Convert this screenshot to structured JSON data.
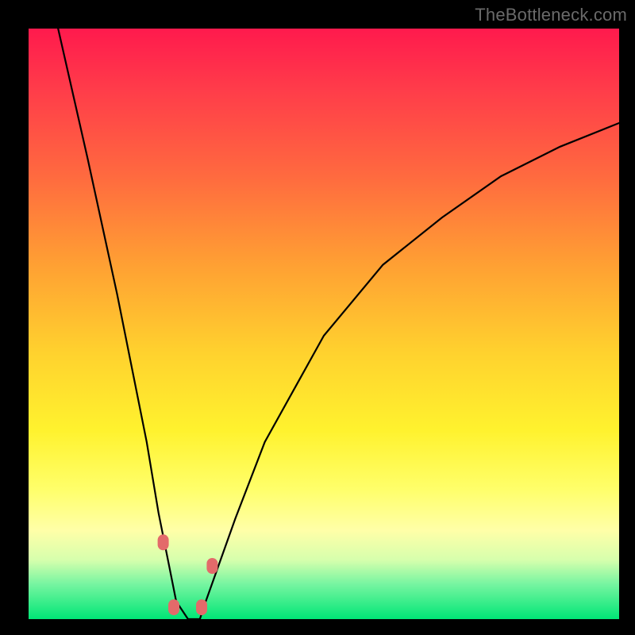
{
  "watermark": "TheBottleneck.com",
  "chart_data": {
    "type": "line",
    "title": "",
    "xlabel": "",
    "ylabel": "",
    "xlim": [
      0,
      100
    ],
    "ylim": [
      0,
      100
    ],
    "grid": false,
    "legend": false,
    "series": [
      {
        "name": "bottleneck-curve",
        "color": "#000000",
        "x": [
          5,
          10,
          15,
          20,
          22,
          24,
          25,
          27,
          29,
          30,
          35,
          40,
          50,
          60,
          70,
          80,
          90,
          100
        ],
        "y": [
          100,
          78,
          55,
          30,
          18,
          8,
          3,
          0,
          0,
          3,
          17,
          30,
          48,
          60,
          68,
          75,
          80,
          84
        ]
      }
    ],
    "markers": [
      {
        "name": "left-marker-upper",
        "x": 22.8,
        "y": 13,
        "color": "#e36a6a"
      },
      {
        "name": "left-marker-lower",
        "x": 24.6,
        "y": 2,
        "color": "#e36a6a"
      },
      {
        "name": "right-marker-lower",
        "x": 29.3,
        "y": 2,
        "color": "#e36a6a"
      },
      {
        "name": "right-marker-upper",
        "x": 31.1,
        "y": 9,
        "color": "#e36a6a"
      }
    ],
    "background_gradient": {
      "top": "#ff1a4d",
      "mid": "#ffd22e",
      "bottom": "#00e676"
    }
  }
}
